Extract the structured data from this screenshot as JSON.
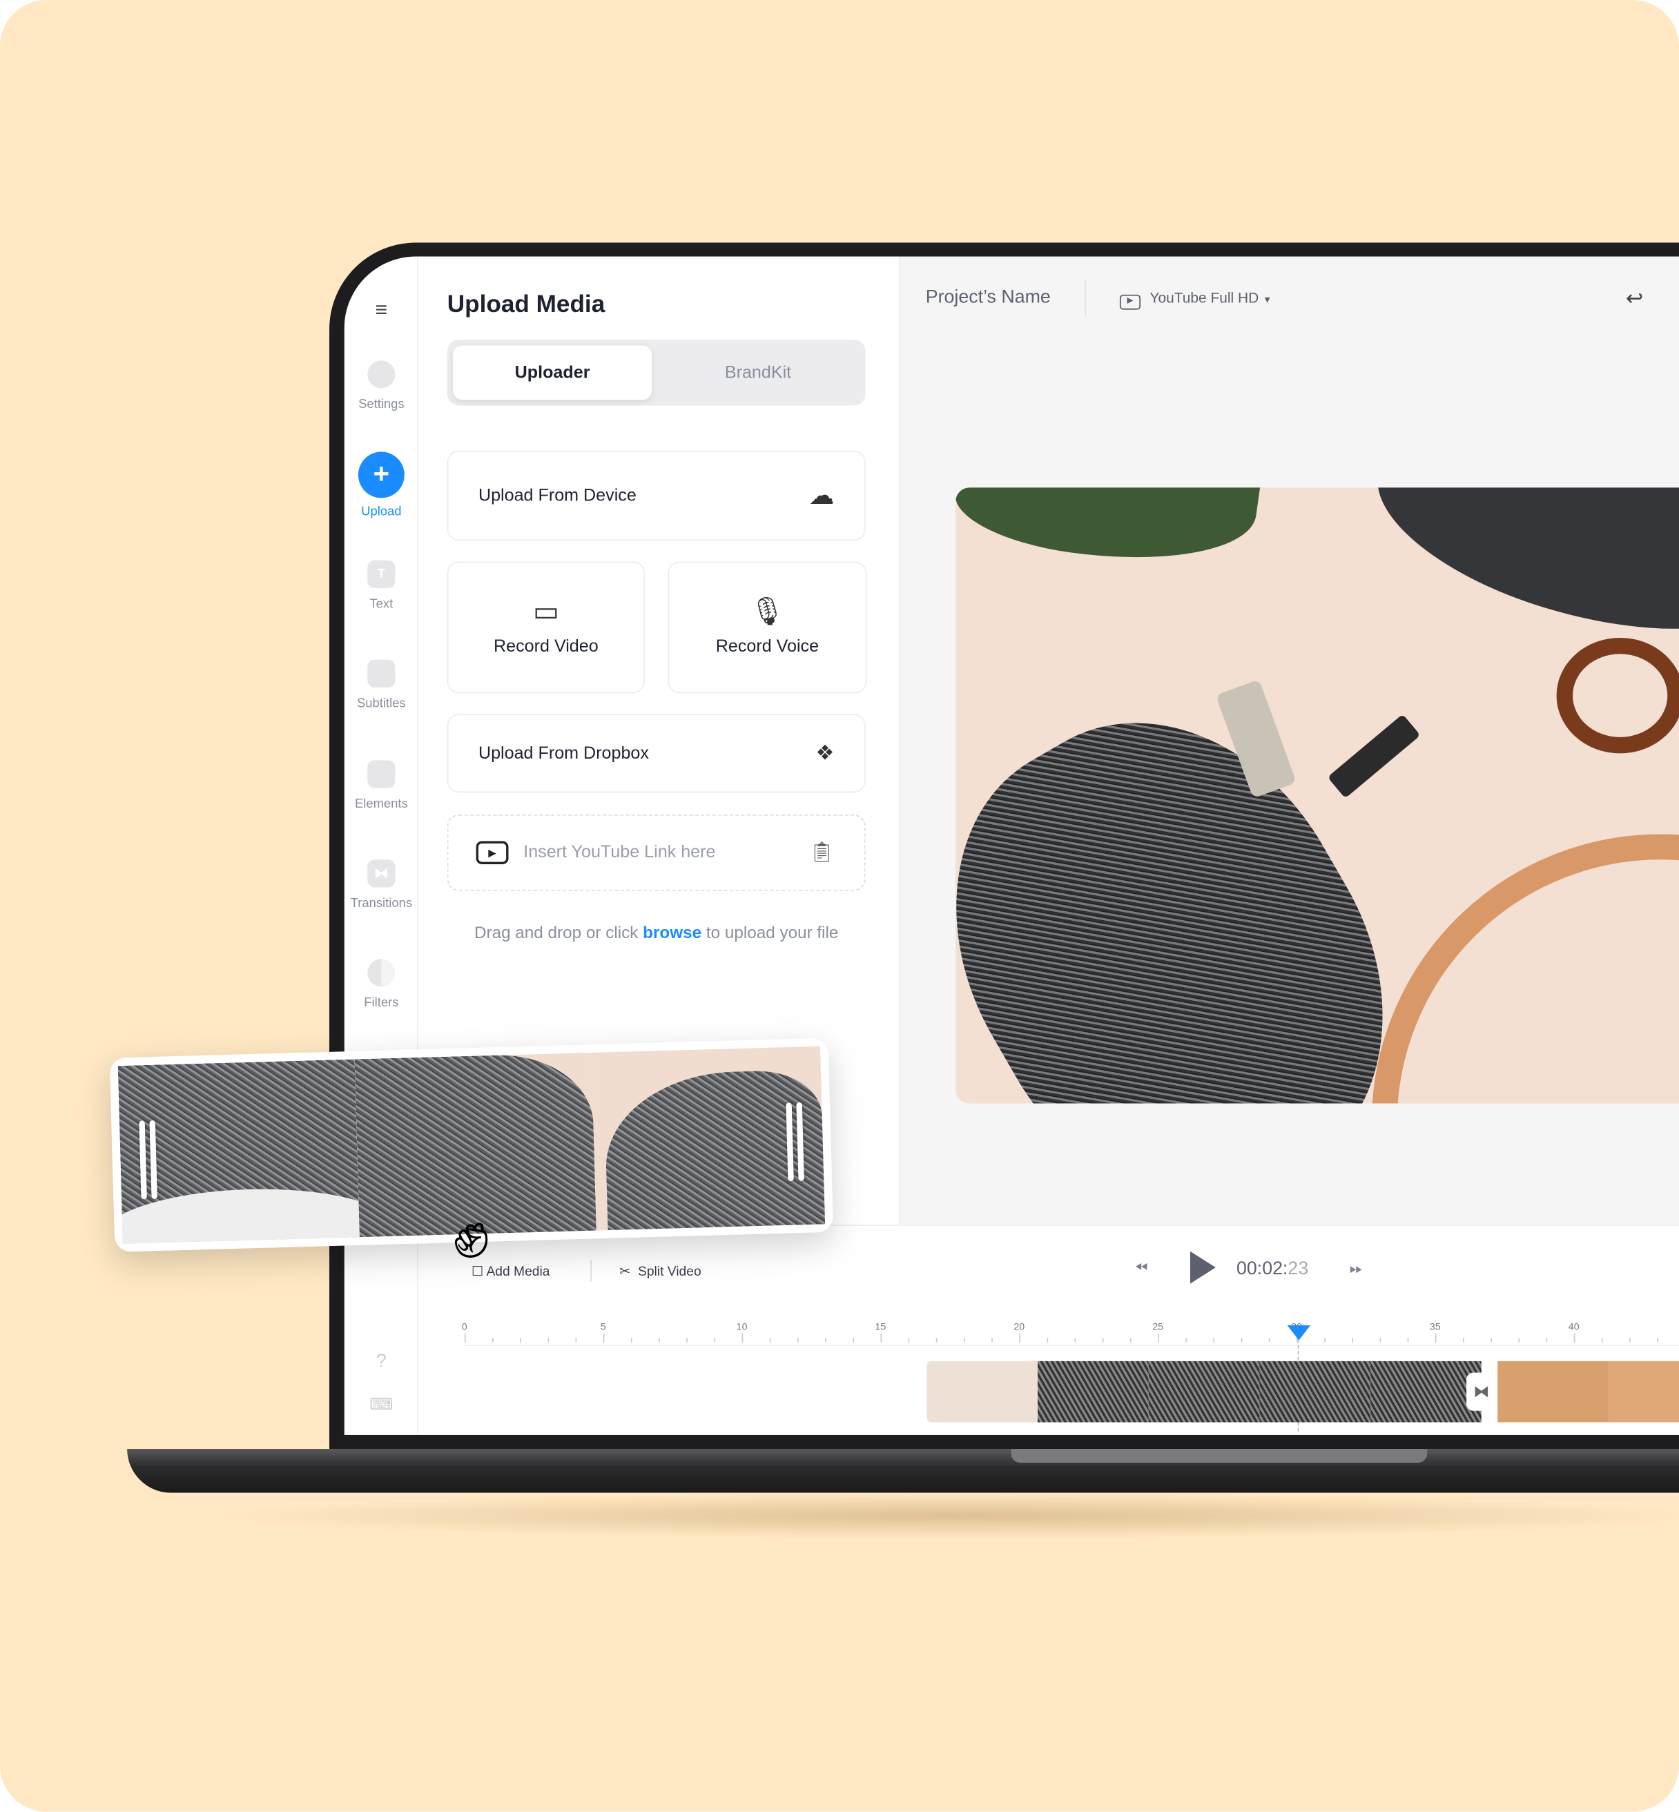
{
  "sidebar": {
    "items": [
      {
        "label": "Settings",
        "icon": "gear-icon"
      },
      {
        "label": "Upload",
        "icon": "plus-icon",
        "active": true
      },
      {
        "label": "Text",
        "icon": "text-icon"
      },
      {
        "label": "Subtitles",
        "icon": "subtitles-icon"
      },
      {
        "label": "Elements",
        "icon": "elements-icon"
      },
      {
        "label": "Transitions",
        "icon": "transitions-icon"
      },
      {
        "label": "Filters",
        "icon": "filters-icon"
      }
    ]
  },
  "panel": {
    "title": "Upload Media",
    "tabs": [
      {
        "label": "Uploader",
        "active": true
      },
      {
        "label": "BrandKit"
      }
    ],
    "upload_device": "Upload From Device",
    "record_video": "Record Video",
    "record_voice": "Record Voice",
    "upload_dropbox": "Upload From Dropbox",
    "youtube_placeholder": "Insert YouTube Link here",
    "hint_before": "Drag and drop or click ",
    "hint_link": "browse",
    "hint_after": " to upload your file"
  },
  "header": {
    "project_name": "Project’s Name",
    "format": "YouTube Full HD"
  },
  "timeline": {
    "add_media": "Add Media",
    "split_video": "Split Video",
    "time_main": "00:02:",
    "time_frames": "23",
    "ticks": [
      "0",
      "5",
      "10",
      "15",
      "20",
      "25",
      "30",
      "35",
      "40"
    ]
  },
  "colors": {
    "accent": "#1A8CFF",
    "background": "#FFE8C3"
  }
}
